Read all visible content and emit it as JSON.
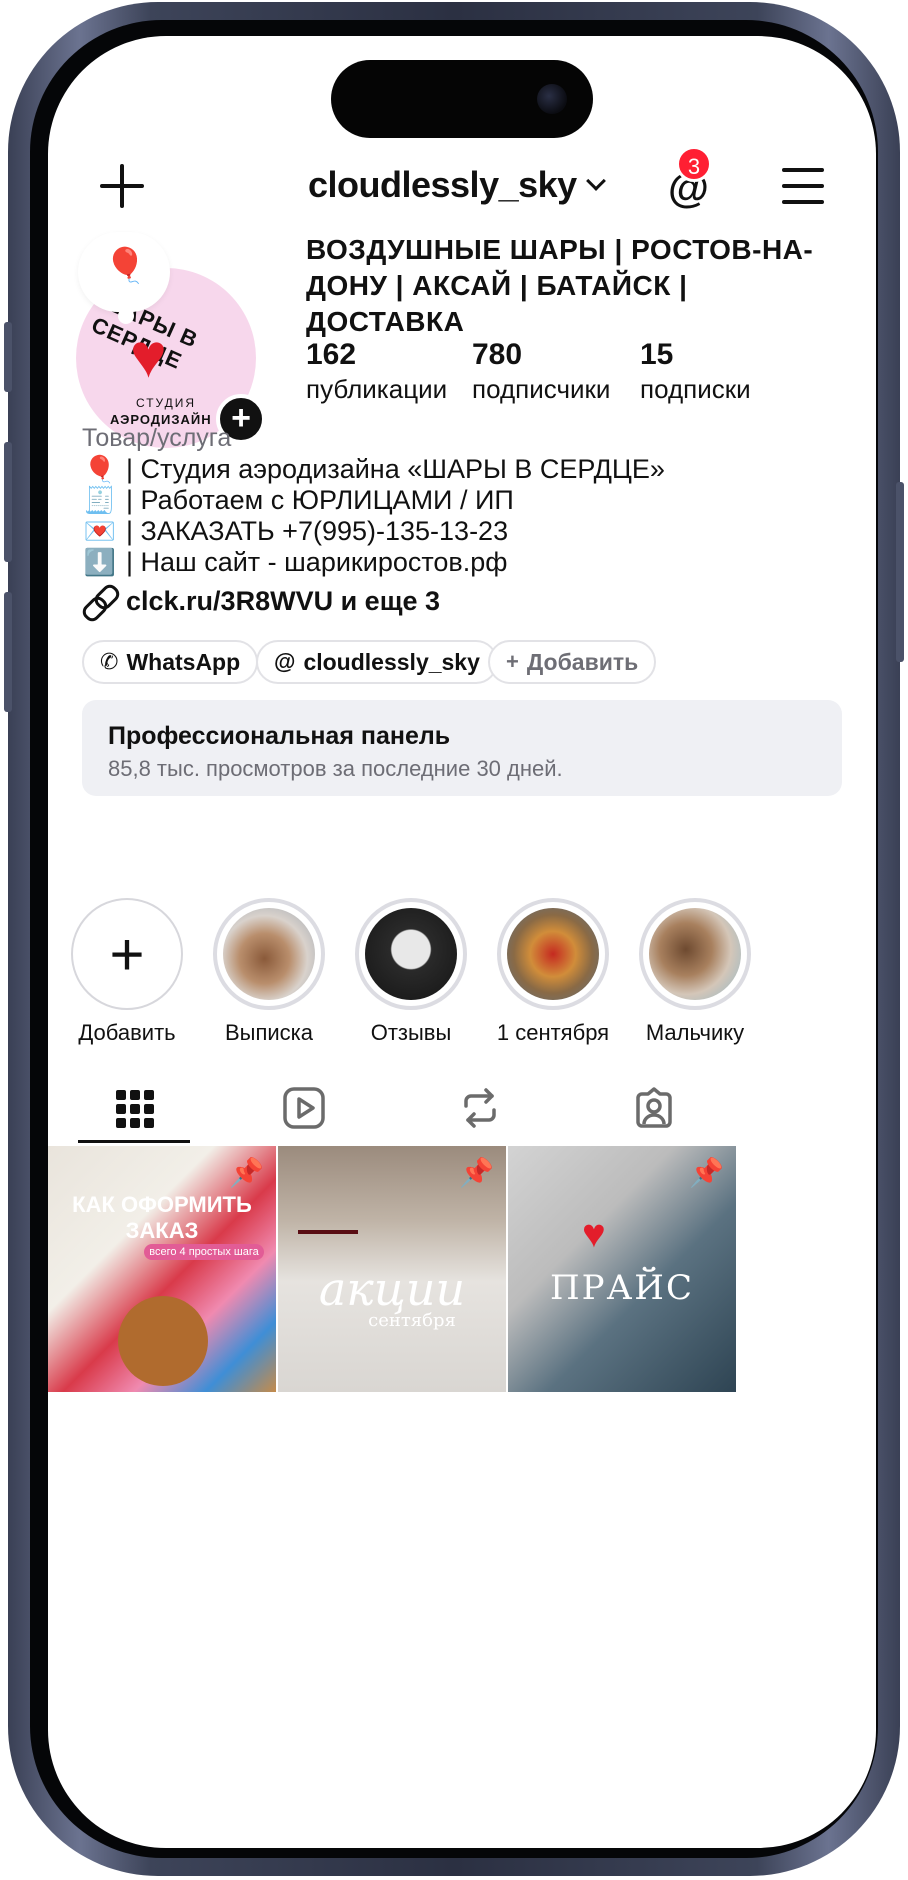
{
  "top_bar": {
    "username": "cloudlessly_sky",
    "notification_count": "3"
  },
  "profile": {
    "avatar_text_top": "ШАРЫ В СЕРДЦЕ",
    "avatar_text_sub1": "СТУДИЯ",
    "avatar_text_sub2": "АЭРОДИЗАЙН",
    "bio_name": "ВОЗДУШНЫЕ ШАРЫ | РОСТОВ-НА-ДОНУ | АКСАЙ |  БАТАЙСК | ДОСТАВКА",
    "stats": [
      {
        "value": "162",
        "label": "публикации"
      },
      {
        "value": "780",
        "label": "подписчики"
      },
      {
        "value": "15",
        "label": "подписки"
      }
    ],
    "category": "Товар/услуга",
    "bio_lines": [
      {
        "emoji": "🎈",
        "text": "| Студия аэродизайна «ШАРЫ В СЕРДЦЕ»"
      },
      {
        "emoji": "🧾",
        "text": "| Работаем с ЮРЛИЦАМИ / ИП"
      },
      {
        "emoji": "💌",
        "text": "| ЗАКАЗАТЬ +7(995)-135-13-23"
      },
      {
        "emoji": "⬇️",
        "text": "| Наш сайт - шарикиростов.рф"
      }
    ],
    "link_text": "clck.ru/3R8WVU и еще 3"
  },
  "pills": [
    {
      "icon": "whatsapp-icon",
      "glyph": "✆",
      "label": "WhatsApp"
    },
    {
      "icon": "threads-icon",
      "glyph": "@",
      "label": "cloudlessly_sky"
    },
    {
      "icon": "plus-icon",
      "glyph": "+",
      "label": "Добавить"
    }
  ],
  "pro_panel": {
    "title": "Профессиональная панель",
    "subtitle": "85,8 тыс. просмотров за последние 30 дней."
  },
  "highlights": [
    {
      "label": "Добавить"
    },
    {
      "label": "Выписка"
    },
    {
      "label": "Отзывы"
    },
    {
      "label": "1 сентября"
    },
    {
      "label": "Мальчику"
    }
  ],
  "tabs": [
    "grid-icon",
    "reels-icon",
    "repost-icon",
    "tagged-icon"
  ],
  "posts": [
    {
      "caption": "КАК ОФОРМИТЬ ЗАКАЗ",
      "sub": "всего 4 простых шага"
    },
    {
      "caption": "акции",
      "sub": "сентября"
    },
    {
      "caption": "ПРАЙС",
      "sub": ""
    }
  ],
  "colors": {
    "badge": "#ff1f33",
    "avatar_bg": "#f7d7ec",
    "heart": "#e31d2b",
    "panel_bg": "#eff0f4"
  }
}
